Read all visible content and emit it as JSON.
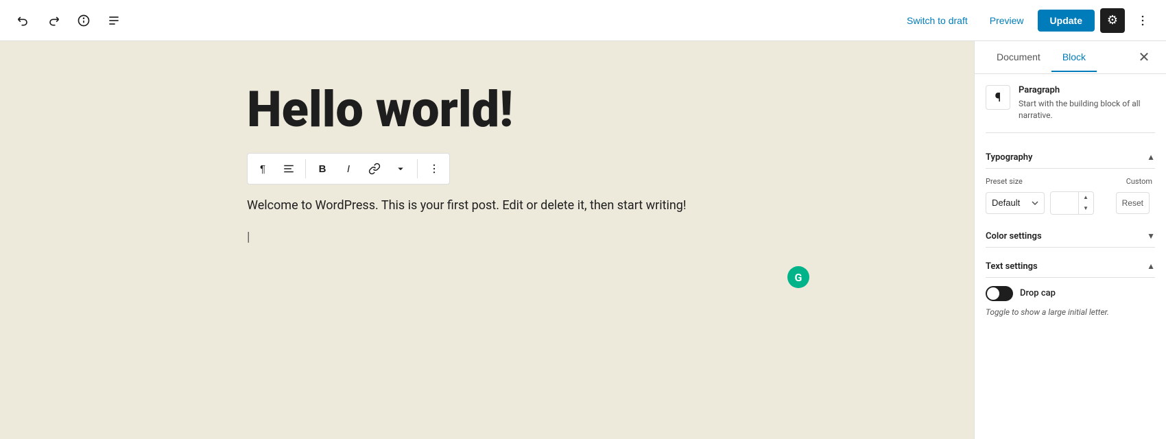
{
  "topbar": {
    "switch_to_draft": "Switch to draft",
    "preview": "Preview",
    "update": "Update"
  },
  "sidebar": {
    "tab_document": "Document",
    "tab_block": "Block",
    "block_name": "Paragraph",
    "block_description": "Start with the building block of all narrative.",
    "typography_label": "Typography",
    "preset_size_label": "Preset size",
    "custom_label": "Custom",
    "preset_default": "Default",
    "reset_label": "Reset",
    "color_settings_label": "Color settings",
    "text_settings_label": "Text settings",
    "drop_cap_label": "Drop cap",
    "drop_cap_desc": "Toggle to show a large initial letter."
  },
  "editor": {
    "title": "Hello world!",
    "body": "Welcome to WordPress. This is your first post. Edit or delete it, then start writing!"
  },
  "toolbar": {
    "paragraph_icon": "¶",
    "align_icon": "≡",
    "bold_icon": "B",
    "italic_icon": "I",
    "link_icon": "🔗",
    "more_icon": "⌄",
    "options_icon": "⋮"
  }
}
